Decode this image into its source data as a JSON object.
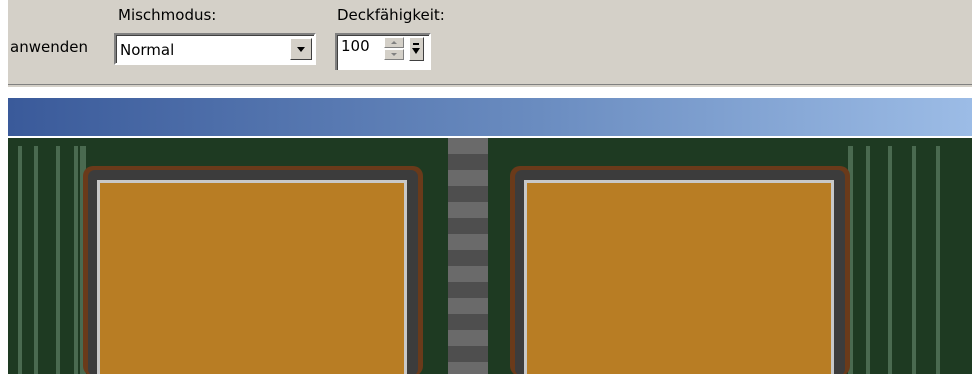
{
  "toolbar": {
    "apply_label": "anwenden",
    "blend_mode_label": "Mischmodus:",
    "blend_mode_value": "Normal",
    "opacity_label": "Deckfähigkeit:",
    "opacity_value": "100"
  },
  "canvas": {
    "colors": {
      "background": "#1e3a22",
      "stripes": "#4a6a50",
      "panel_fill": "#b87d24",
      "panel_border_outer": "#6a3a1a",
      "panel_border_dark": "#3c3c3c",
      "panel_inner_line": "#c8c8c8",
      "checker_light": "#6a6a6a",
      "checker_dark": "#4e4e4e"
    }
  }
}
